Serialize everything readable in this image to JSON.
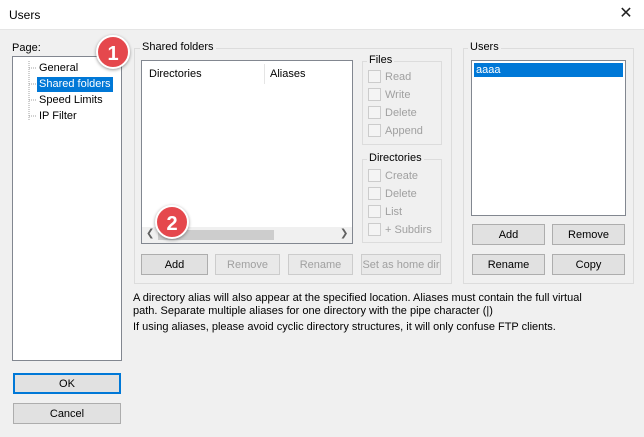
{
  "window": {
    "title": "Users",
    "close_glyph": "✕"
  },
  "page_panel": {
    "label": "Page:",
    "items": [
      "General",
      "Shared folders",
      "Speed Limits",
      "IP Filter"
    ],
    "selected": "Shared folders"
  },
  "shared_folders": {
    "label": "Shared folders",
    "columns": [
      "Directories",
      "Aliases"
    ],
    "buttons": {
      "add": "Add",
      "remove": "Remove",
      "rename": "Rename",
      "set_home": "Set as home dir"
    }
  },
  "files": {
    "label": "Files",
    "options": [
      "Read",
      "Write",
      "Delete",
      "Append"
    ]
  },
  "directories": {
    "label": "Directories",
    "options": [
      "Create",
      "Delete",
      "List",
      "+ Subdirs"
    ]
  },
  "users": {
    "label": "Users",
    "items": [
      "aaaa"
    ],
    "buttons": {
      "add": "Add",
      "remove": "Remove",
      "rename": "Rename",
      "copy": "Copy"
    }
  },
  "info": {
    "line1": "A directory alias will also appear at the specified location. Aliases must contain the full virtual",
    "line2": "path. Separate multiple aliases for one directory with the pipe character (|)",
    "line3": "If using aliases, please avoid cyclic directory structures, it will only confuse FTP clients."
  },
  "dialog_buttons": {
    "ok": "OK",
    "cancel": "Cancel"
  },
  "annotations": {
    "badge1": "1",
    "badge2": "2"
  },
  "colors": {
    "selection": "#0078d7",
    "badge": "#e5484d"
  }
}
